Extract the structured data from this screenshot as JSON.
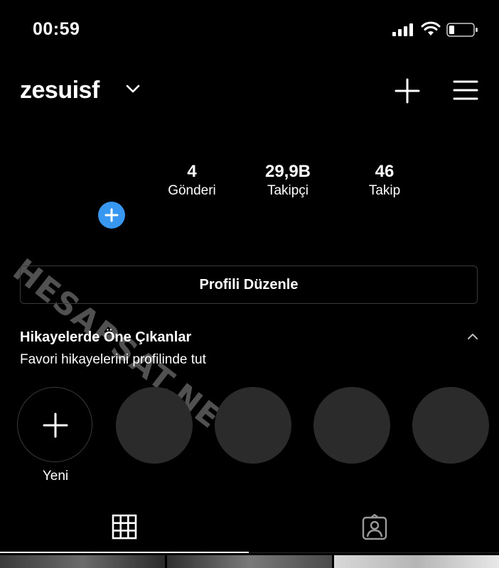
{
  "status_bar": {
    "time": "00:59"
  },
  "header": {
    "username": "zesuisf"
  },
  "stats": [
    {
      "value": "4",
      "label": "Gönderi"
    },
    {
      "value": "29,9B",
      "label": "Takipçi"
    },
    {
      "value": "46",
      "label": "Takip"
    }
  ],
  "watermark": "HESAPSAT.NET",
  "edit_profile_label": "Profili Düzenle",
  "highlights": {
    "title": "Hikayelerde Öne Çıkanlar",
    "subtitle": "Favori hikayelerini profilinde tut",
    "new_label": "Yeni"
  },
  "icons": [
    "chevron-down-icon",
    "plus-icon",
    "menu-icon",
    "grid-icon",
    "tagged-icon",
    "signal-icon",
    "wifi-icon",
    "battery-icon"
  ],
  "colors": {
    "background": "#000000",
    "accent_blue": "#3897f0",
    "placeholder": "#2b2b2b",
    "border": "#3a3a3a"
  }
}
